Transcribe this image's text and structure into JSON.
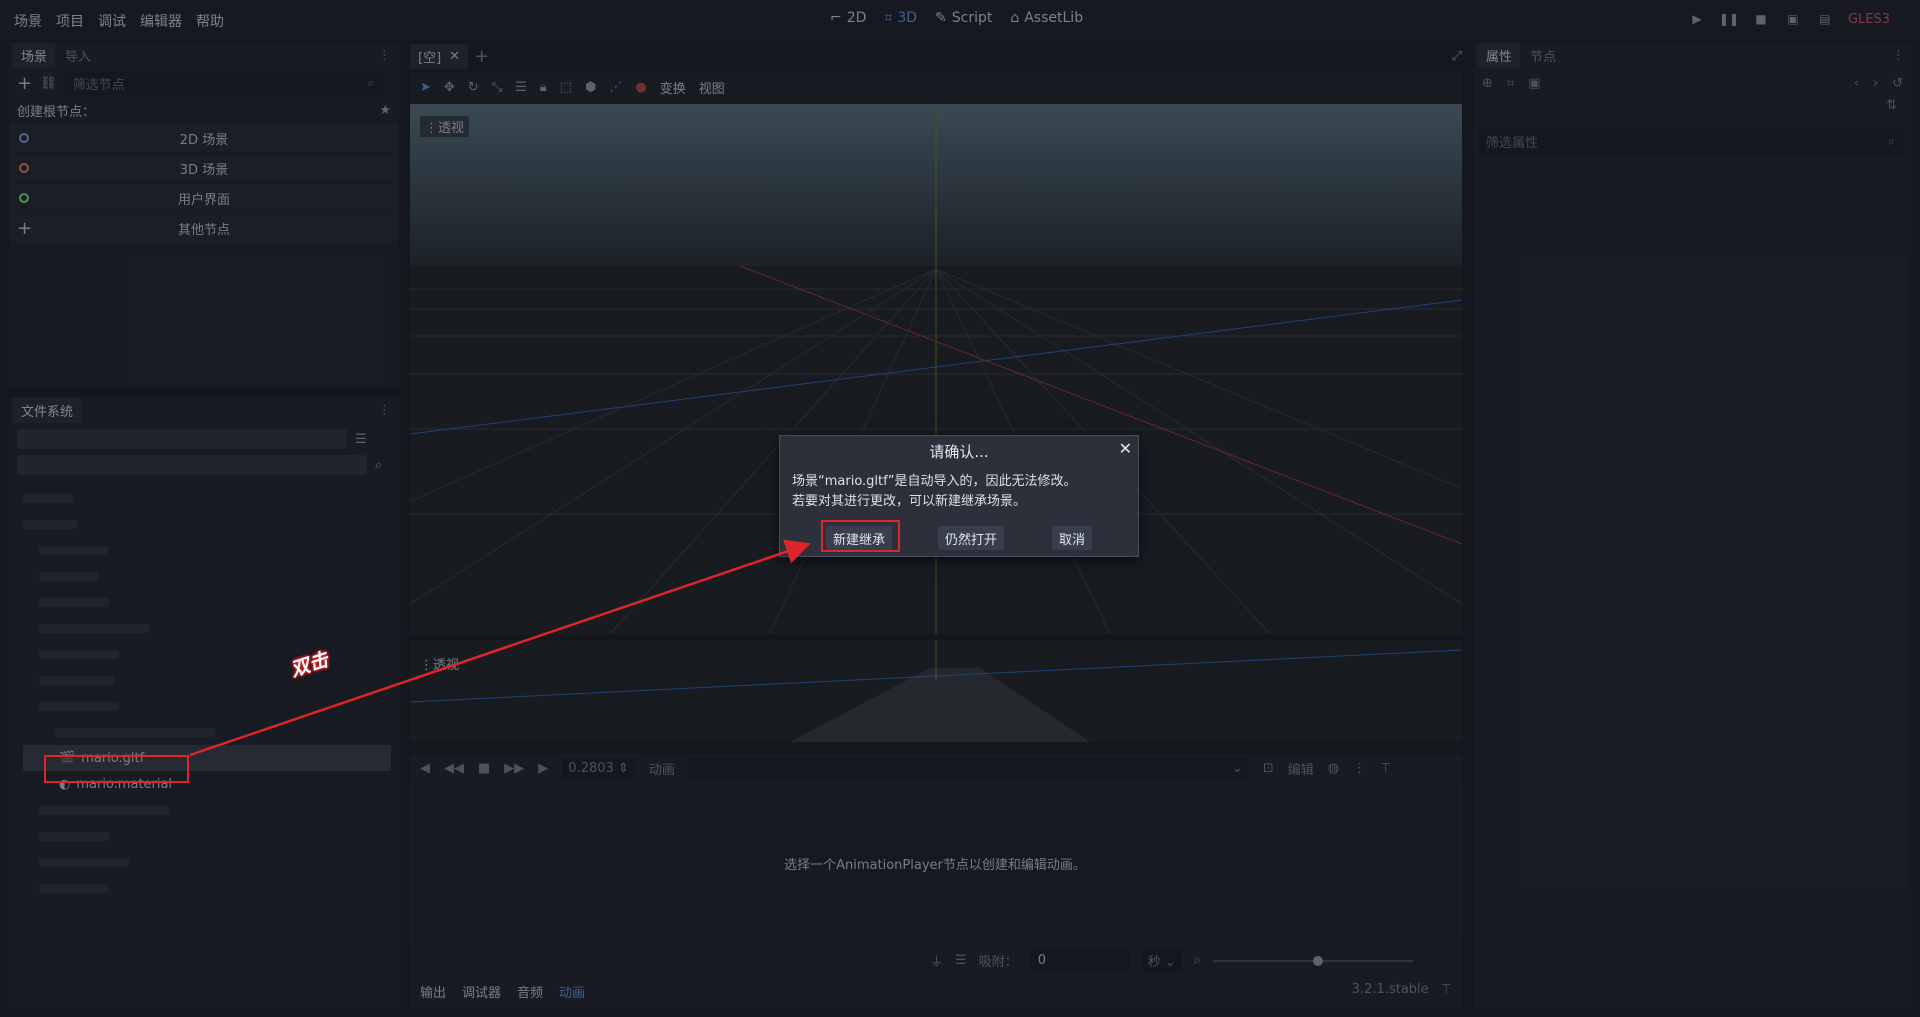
{
  "menu": [
    "场景",
    "项目",
    "调试",
    "编辑器",
    "帮助"
  ],
  "modes": [
    {
      "label": "2D",
      "active": false
    },
    {
      "label": "3D",
      "active": true
    },
    {
      "label": "Script",
      "active": false
    },
    {
      "label": "AssetLib",
      "active": false
    }
  ],
  "renderer": "GLES3",
  "scene_dock": {
    "tabs": [
      "场景",
      "导入"
    ],
    "filter_placeholder": "筛选节点",
    "create_root_label": "创建根节点：",
    "root_buttons": [
      {
        "label": "2D 场景",
        "color": "#8fa3e8"
      },
      {
        "label": "3D 场景",
        "color": "#fc7f7f"
      },
      {
        "label": "用户界面",
        "color": "#8eef97"
      },
      {
        "label": "其他节点",
        "color": "#c8cdd6"
      }
    ]
  },
  "filesystem": {
    "tab": "文件系统",
    "selected_file": "mario.gltf",
    "file2": "mario.material"
  },
  "editor": {
    "scene_tab": "[空]",
    "toolbar_menus": [
      "变换",
      "视图"
    ],
    "viewport_label_top": "透视",
    "viewport_label_bottom": "透视"
  },
  "dialog": {
    "title": "请确认...",
    "line1": "场景“mario.gltf”是自动导入的，因此无法修改。",
    "line2": "若要对其进行更改，可以新建继承场景。",
    "btn_new_inherited": "新建继承",
    "btn_open_anyway": "仍然打开",
    "btn_cancel": "取消"
  },
  "annotation": {
    "text": "双击",
    "color": "#e0242c"
  },
  "animation": {
    "time": "0.2803",
    "anim_dropdown": "动画",
    "edit_label": "编辑",
    "empty_msg": "选择一个AnimationPlayer节点以创建和编辑动画。",
    "snap_label": "吸附：",
    "snap_value": "0",
    "unit": "秒"
  },
  "bottom_tabs": [
    {
      "label": "输出",
      "active": false
    },
    {
      "label": "调试器",
      "active": false
    },
    {
      "label": "音频",
      "active": false
    },
    {
      "label": "动画",
      "active": true
    }
  ],
  "version": "3.2.1.stable",
  "inspector": {
    "tabs": [
      "属性",
      "节点"
    ],
    "filter_placeholder": "筛选属性"
  }
}
